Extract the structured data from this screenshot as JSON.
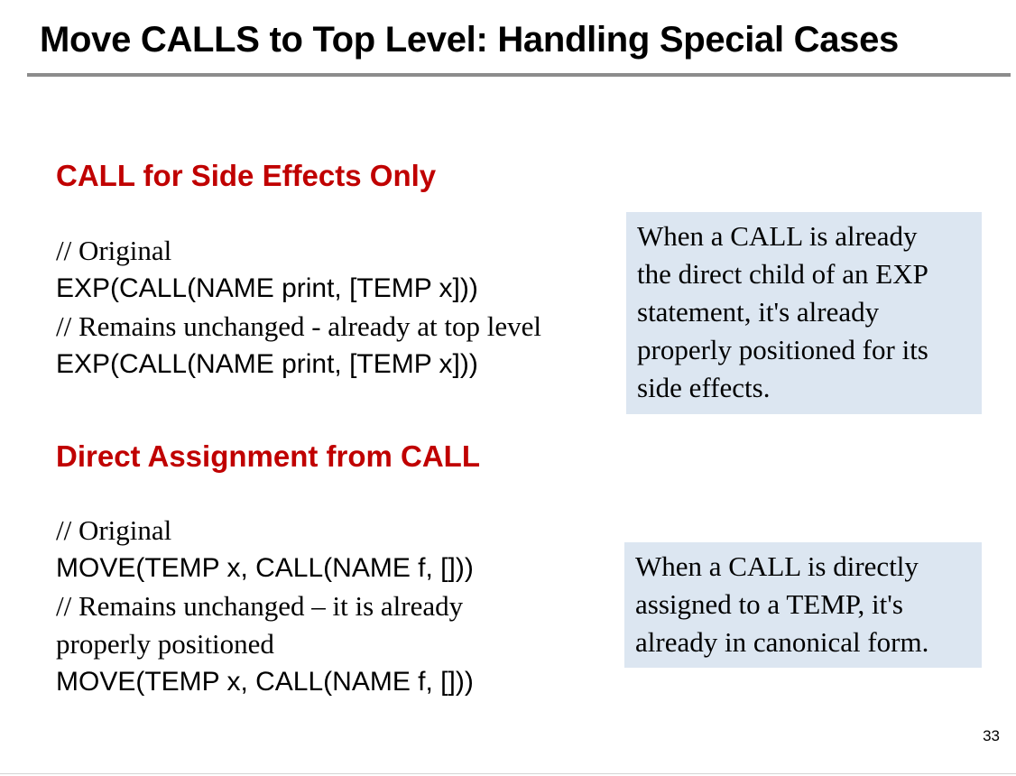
{
  "slide": {
    "title": "Move CALLS to Top Level: Handling Special Cases",
    "page_number": "33"
  },
  "colors": {
    "heading": "#c00000",
    "note_background": "#dce6f1",
    "title_rule": "#8c8c8c"
  },
  "section_side_effects": {
    "heading": "CALL for Side Effects Only",
    "lines": [
      "// Original",
      "EXP(CALL(NAME print, [TEMP x]))",
      "// Remains unchanged - already at top level",
      "EXP(CALL(NAME print, [TEMP x]))"
    ],
    "note_lines": [
      "When a CALL is already",
      "the direct child of an EXP",
      "statement, it's already",
      "properly positioned for its",
      "side effects."
    ]
  },
  "section_direct_assignment": {
    "heading": "Direct Assignment from CALL",
    "lines": [
      "// Original",
      "MOVE(TEMP x, CALL(NAME f, []))",
      "// Remains unchanged – it is already",
      "properly positioned",
      "MOVE(TEMP x, CALL(NAME f, []))"
    ],
    "note_lines": [
      "When a CALL is directly",
      "assigned to a TEMP, it's",
      "already in canonical form."
    ]
  }
}
